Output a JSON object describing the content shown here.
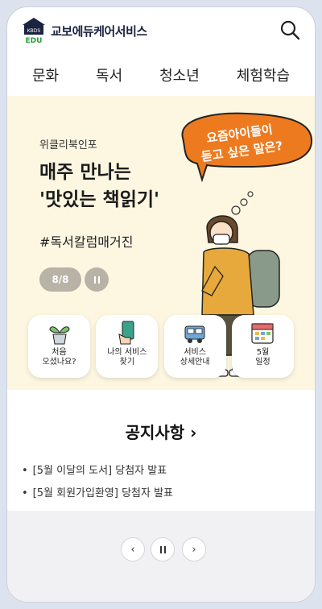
{
  "header": {
    "logo_badge": "KBDS",
    "logo_sub": "EDU",
    "logo_text": "교보에듀케어서비스",
    "search_icon": "search-icon"
  },
  "nav": {
    "items": [
      {
        "label": "문화"
      },
      {
        "label": "독서"
      },
      {
        "label": "청소년"
      },
      {
        "label": "체험학습"
      }
    ]
  },
  "banner": {
    "category": "위클리북인포",
    "title_line1": "매주 만나는",
    "title_line2": "'맛있는 책읽기'",
    "hashtag": "#독서칼럼매거진",
    "pager": "8/8",
    "bubble_line1": "요즘아이들이",
    "bubble_line2": "듣고 싶은 말은?",
    "bubble_color": "#ee7a1f",
    "background": "#fdf7e1"
  },
  "quick_menu": [
    {
      "label": "처음\n오셨나요?",
      "icon": "sprout-icon"
    },
    {
      "label": "나의 서비스\n찾기",
      "icon": "phone-hand-icon"
    },
    {
      "label": "서비스\n상세안내",
      "icon": "bus-icon"
    },
    {
      "label": "5월\n일정",
      "icon": "calendar-icon"
    }
  ],
  "notice": {
    "title": "공지사항 ›",
    "items": [
      {
        "text": "[5월 이달의 도서] 당첨자 발표"
      },
      {
        "text": "[5월 회원가입환영] 당첨자 발표"
      }
    ]
  },
  "controls": {
    "prev": "‹",
    "next": "›"
  }
}
